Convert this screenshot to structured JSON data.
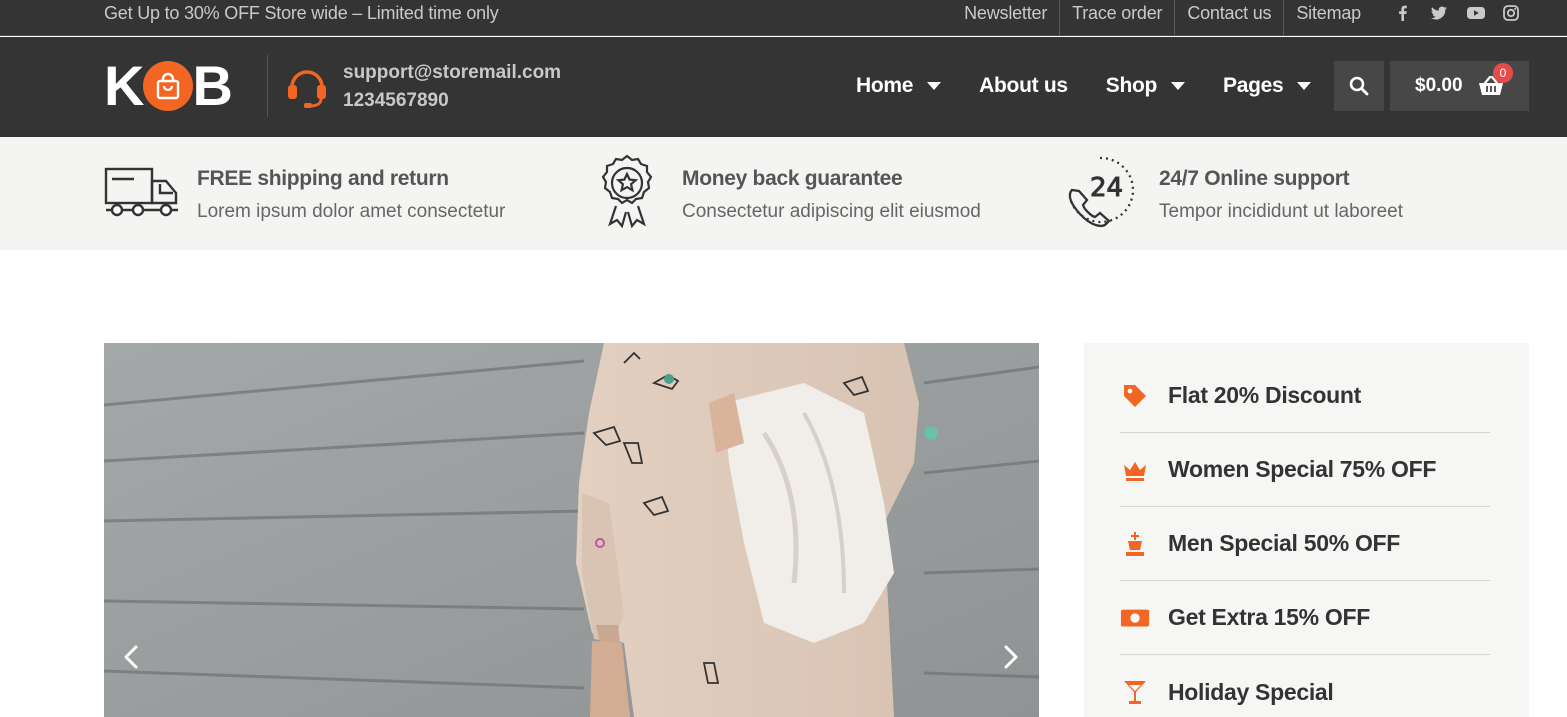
{
  "topbar": {
    "promo": "Get Up to 30% OFF Store wide – Limited time only",
    "links": [
      "Newsletter",
      "Trace order",
      "Contact us",
      "Sitemap"
    ],
    "socials": [
      "facebook-icon",
      "twitter-icon",
      "youtube-icon",
      "instagram-icon"
    ]
  },
  "header": {
    "logo_left": "K",
    "logo_right": "B",
    "support_email": "support@storemail.com",
    "support_phone": "1234567890",
    "nav": [
      {
        "label": "Home",
        "has_dropdown": true
      },
      {
        "label": "About us",
        "has_dropdown": false
      },
      {
        "label": "Shop",
        "has_dropdown": true
      },
      {
        "label": "Pages",
        "has_dropdown": true
      }
    ],
    "cart_total": "$0.00",
    "cart_count": "0"
  },
  "features": [
    {
      "icon": "truck-icon",
      "title": "FREE shipping and return",
      "subtitle": "Lorem ipsum dolor amet consectetur"
    },
    {
      "icon": "badge-star-icon",
      "title": "Money back guarantee",
      "subtitle": "Consectetur adipiscing elit eiusmod"
    },
    {
      "icon": "phone-24-icon",
      "title": "24/7 Online support",
      "subtitle": "Tempor incididunt ut laboreet"
    }
  ],
  "offers": [
    {
      "icon": "tag-icon",
      "label": "Flat 20% Discount"
    },
    {
      "icon": "crown-icon",
      "label": "Women Special 75% OFF"
    },
    {
      "icon": "king-chess-icon",
      "label": "Men Special 50% OFF"
    },
    {
      "icon": "money-icon",
      "label": "Get Extra 15% OFF"
    },
    {
      "icon": "cocktail-icon",
      "label": "Holiday Special"
    }
  ],
  "colors": {
    "accent": "#f26522",
    "dark_bg": "#343434",
    "strip_bg": "#f4f4f2"
  }
}
